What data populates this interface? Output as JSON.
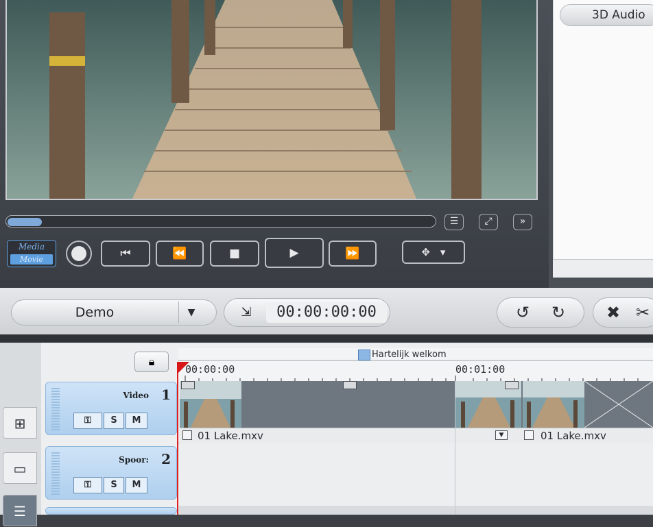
{
  "preview": {
    "media_label": "Media",
    "movie_label": "Movie",
    "transport": {
      "first": "⏮",
      "rewind": "⏪",
      "stop": "■",
      "play": "▶",
      "forward": "⏩"
    }
  },
  "right_panel": {
    "audio_button": "3D Audio"
  },
  "toolbar": {
    "project_name": "Demo",
    "timecode": "00:00:00:00"
  },
  "timeline": {
    "marker_label": "Hartelijk welkom",
    "ruler_start": "00:00:00",
    "ruler_mid": "00:01:00",
    "tracks": [
      {
        "name": "Video",
        "number": "1",
        "solo": "S",
        "mute": "M"
      },
      {
        "name": "Spoor:",
        "number": "2",
        "solo": "S",
        "mute": "M"
      }
    ],
    "clips": [
      {
        "name": "01 Lake.mxv"
      },
      {
        "name": "01 Lake.mxv"
      }
    ]
  },
  "icons": {
    "list": "list-icon",
    "fullscreen": "fullscreen-icon",
    "more": "chevrons-down-icon",
    "lock": "lock-icon",
    "undo": "undo-icon",
    "redo": "redo-icon",
    "delete": "delete-icon",
    "cut": "scissors-icon"
  },
  "colors": {
    "accent": "#5e9fe0",
    "playhead": "#e02020",
    "track_header": "#aecfee",
    "clip_body": "#6e7780"
  }
}
